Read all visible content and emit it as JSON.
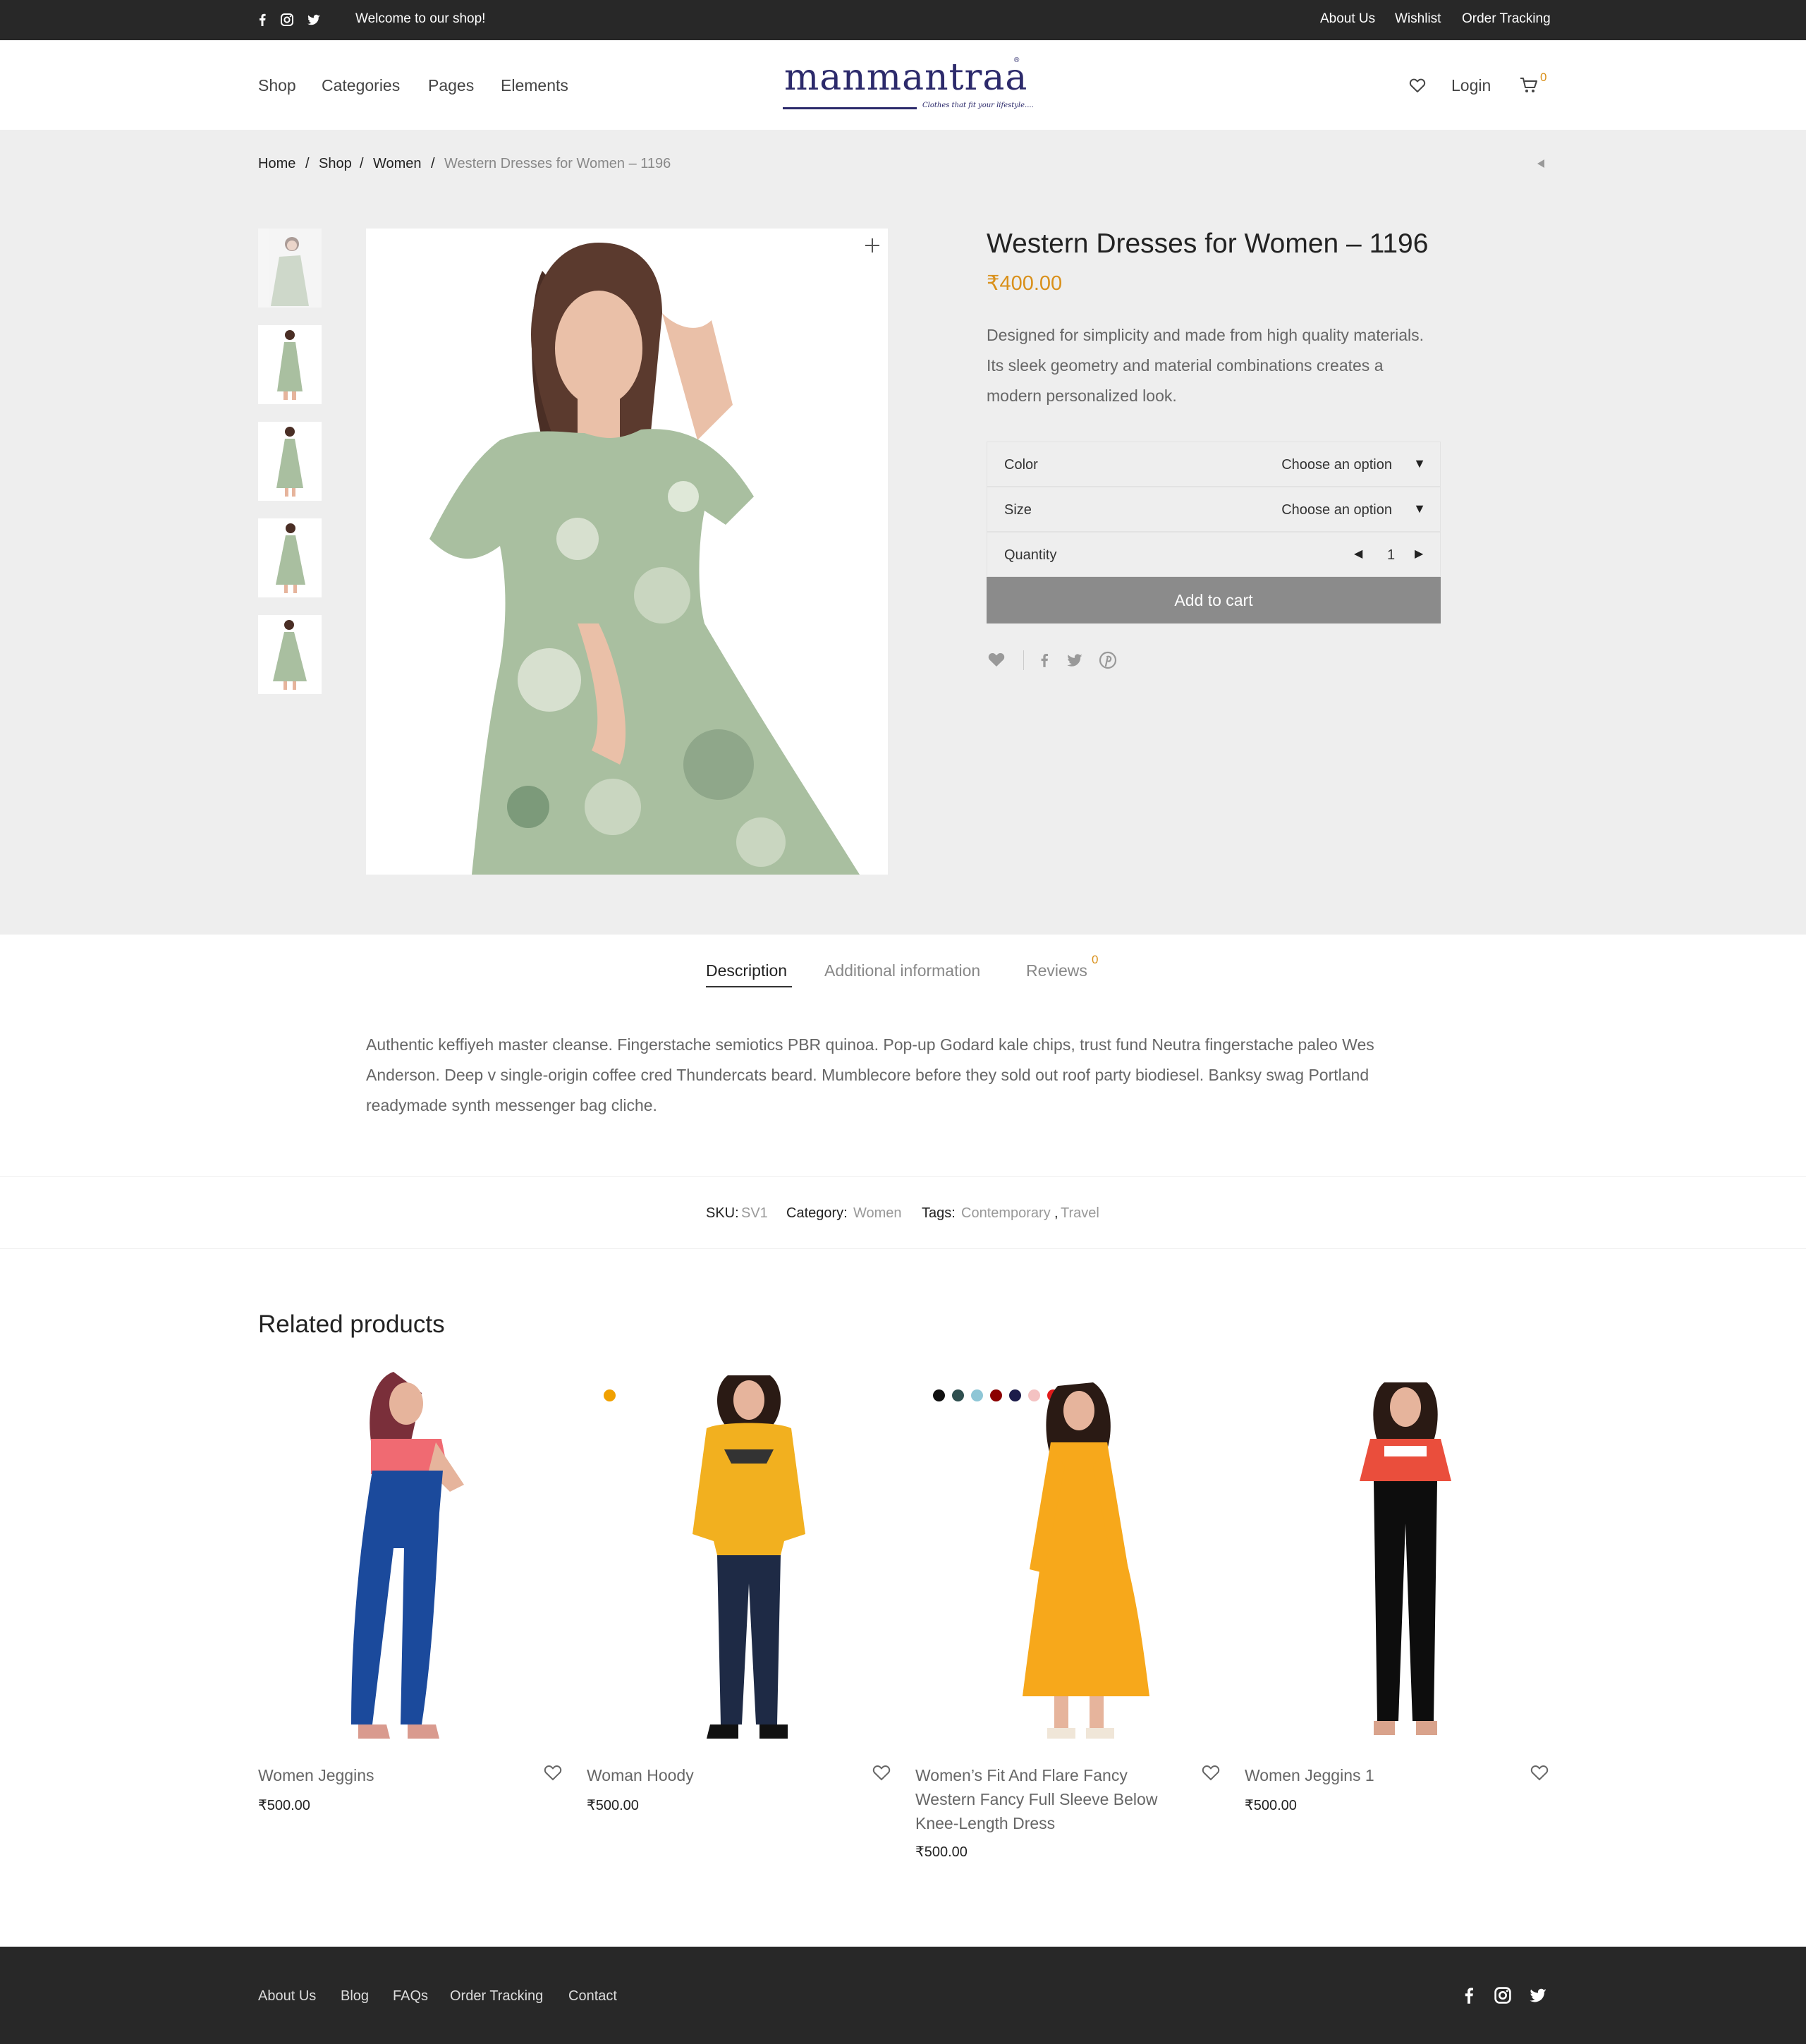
{
  "topbar": {
    "welcome": "Welcome to our shop!",
    "links": [
      "About Us",
      "Wishlist",
      "Order Tracking"
    ]
  },
  "header": {
    "nav": [
      "Shop",
      "Categories",
      "Pages",
      "Elements"
    ],
    "logo_text": "manmantraa",
    "logo_tagline": "Clothes that fit your lifestyle....",
    "login": "Login",
    "cart_count": "0"
  },
  "breadcrumb": {
    "items": [
      "Home",
      "Shop",
      "Women"
    ],
    "current": "Western Dresses for Women – 1196",
    "separator": "/"
  },
  "product": {
    "title": "Western Dresses for Women – 1196",
    "price": "₹400.00",
    "description": "Designed for simplicity and made from high quality materials. Its sleek geometry and material combinations creates a modern personalized look.",
    "color_label": "Color",
    "color_value": "Choose an option",
    "size_label": "Size",
    "size_value": "Choose an option",
    "quantity_label": "Quantity",
    "quantity": "1",
    "add_to_cart": "Add to cart",
    "dress_color": "#a9bfa0",
    "accent": "#d9901a"
  },
  "tabs": {
    "description": "Description",
    "additional": "Additional information",
    "reviews": "Reviews",
    "reviews_count": "0"
  },
  "long_description": "Authentic keffiyeh master cleanse. Fingerstache semiotics PBR quinoa. Pop-up Godard kale chips, trust fund Neutra fingerstache paleo Wes Anderson. Deep v single-origin coffee cred Thundercats beard. Mumblecore before they sold out roof party biodiesel. Banksy swag Portland readymade synth messenger bag cliche.",
  "meta": {
    "sku_label": "SKU:",
    "sku": "SV1",
    "category_label": "Category:",
    "category": "Women",
    "tags_label": "Tags:",
    "tag1": "Contemporary",
    "tag_sep": ",",
    "tag2": "Travel"
  },
  "related": {
    "title": "Related products",
    "products": [
      {
        "name": "Women Jeggins",
        "price": "₹500.00"
      },
      {
        "name": "Woman Hoody",
        "price": "₹500.00"
      },
      {
        "name": "Women’s Fit And Flare Fancy Western Fancy Full Sleeve Below Knee-Length Dress",
        "price": "₹500.00"
      },
      {
        "name": "Women Jeggins 1",
        "price": "₹500.00"
      }
    ],
    "hoody_swatches": [
      "#f0a000"
    ],
    "dress_swatches": [
      "#111111",
      "#2f4f4f",
      "#8ec6d6",
      "#8b0000",
      "#1c1c4a",
      "#f4c2c2",
      "#e01b1b",
      "#2447c4",
      "#f5a300"
    ]
  },
  "footer": {
    "links": [
      "About Us",
      "Blog",
      "FAQs",
      "Order Tracking",
      "Contact"
    ]
  }
}
